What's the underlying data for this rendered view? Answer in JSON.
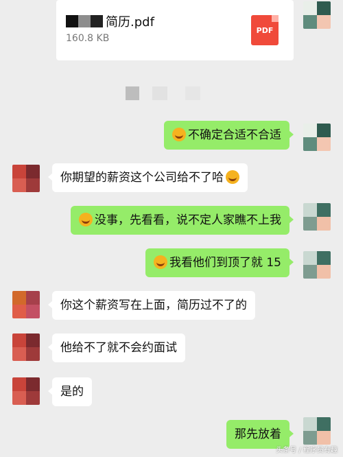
{
  "file": {
    "name_suffix": "简历.pdf",
    "size": "160.8 KB",
    "icon_label": "PDF"
  },
  "messages": [
    {
      "side": "right",
      "text": "不确定合适不合适",
      "emoji": true
    },
    {
      "side": "left",
      "text": "你期望的薪资这个公司给不了哈",
      "emoji_end": true
    },
    {
      "side": "right",
      "text": "没事，先看看，说不定人家瞧不上我",
      "emoji": true
    },
    {
      "side": "right",
      "text": "我看他们到顶了就 15",
      "emoji": true
    },
    {
      "side": "left",
      "text": "你这个薪资写在上面，简历过不了的"
    },
    {
      "side": "left",
      "text": "他给不了就不会约面试"
    },
    {
      "side": "left",
      "text": "是的"
    },
    {
      "side": "right",
      "text": "那先放着"
    }
  ],
  "watermark": "头条号 / 程序员有趣",
  "colors": {
    "green_bubble": "#95ec69",
    "background": "#ededed"
  }
}
